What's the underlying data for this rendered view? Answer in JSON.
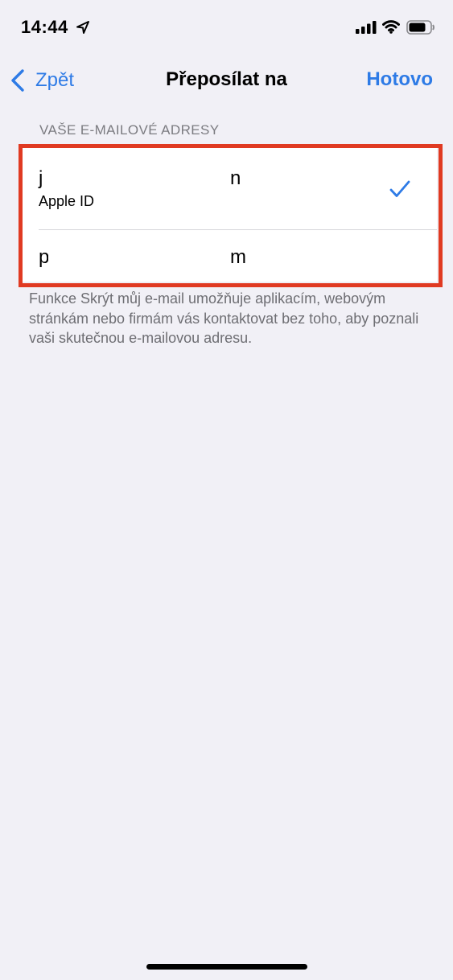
{
  "status_bar": {
    "time": "14:44",
    "icons": [
      "location-arrow-icon",
      "cellular-signal-icon",
      "wifi-icon",
      "battery-icon"
    ]
  },
  "nav": {
    "back_label": "Zpět",
    "title": "Přeposílat na",
    "done_label": "Hotovo"
  },
  "section": {
    "header": "VAŠE E-MAILOVÉ ADRESY",
    "rows": [
      {
        "email_prefix": "j",
        "email_suffix": "n",
        "sub_label": "Apple ID",
        "selected": true
      },
      {
        "email_prefix": "p",
        "email_suffix": "m",
        "selected": false
      }
    ],
    "footer": "Funkce Skrýt můj e-mail umožňuje aplikacím, webovým stránkám nebo firmám vás kontaktovat bez toho, aby poznali vaši skutečnou e-mailovou adresu."
  },
  "colors": {
    "accent": "#2e7be6",
    "highlight": "#e03a22",
    "background": "#f1f0f6"
  }
}
